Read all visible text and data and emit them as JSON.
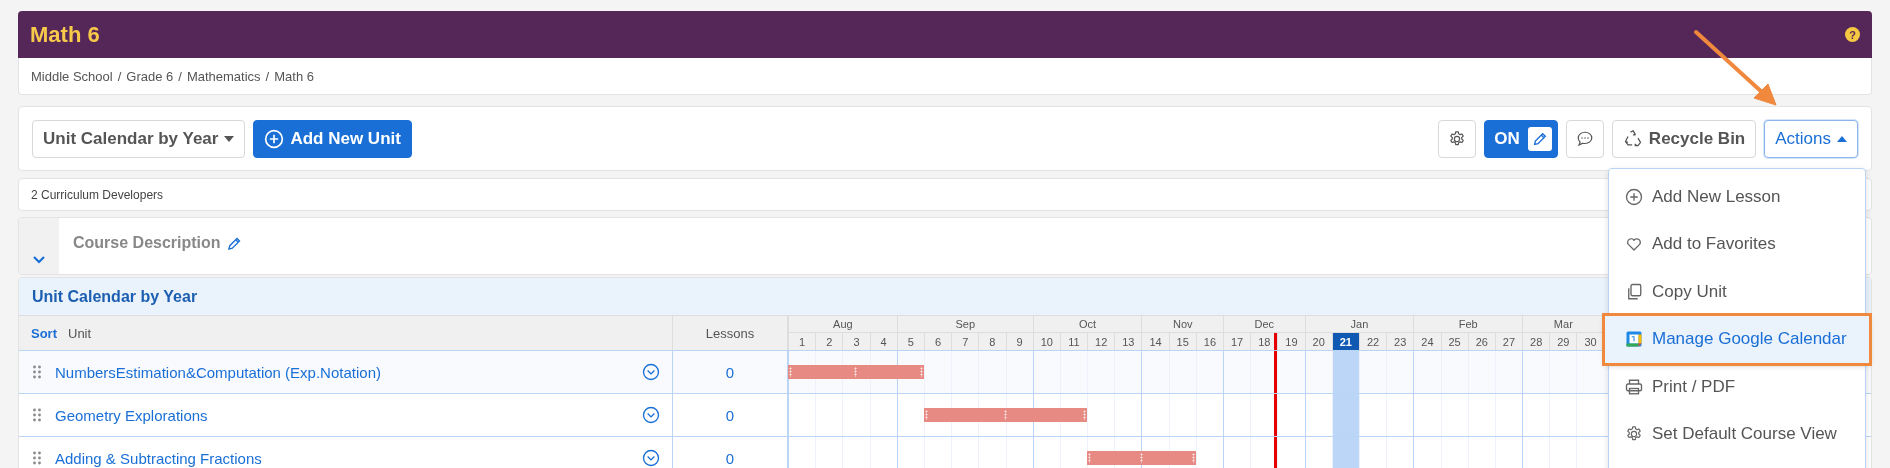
{
  "header": {
    "title": "Math 6",
    "help": "?"
  },
  "breadcrumb": {
    "separator": "/",
    "items": [
      "Middle School",
      "Grade 6",
      "Mathematics",
      "Math 6"
    ]
  },
  "toolbar": {
    "view_select": "Unit Calendar by Year",
    "add_unit": "Add New Unit",
    "edit_toggle": {
      "label": "ON",
      "on": true
    },
    "recycle_bin": "Recycle Bin",
    "actions": {
      "label": "Actions",
      "expanded": true
    }
  },
  "developers": "2 Curriculum Developers",
  "course_description": {
    "label": "Course Description",
    "expanded": false
  },
  "calendar": {
    "title": "Unit Calendar by Year",
    "columns": {
      "sort": "Sort",
      "unit": "Unit",
      "lessons": "Lessons"
    },
    "months": [
      {
        "label": "Aug",
        "weeks": [
          {
            "label": "1",
            "selected": false,
            "today": false
          },
          {
            "label": "2",
            "selected": false,
            "today": false
          },
          {
            "label": "3",
            "selected": false,
            "today": false
          },
          {
            "label": "4",
            "selected": false,
            "today": false
          }
        ]
      },
      {
        "label": "Sep",
        "weeks": [
          {
            "label": "5",
            "selected": false,
            "today": false
          },
          {
            "label": "6",
            "selected": false,
            "today": false
          },
          {
            "label": "7",
            "selected": false,
            "today": false
          },
          {
            "label": "8",
            "selected": false,
            "today": false
          },
          {
            "label": "9",
            "selected": false,
            "today": false
          }
        ]
      },
      {
        "label": "Oct",
        "weeks": [
          {
            "label": "10",
            "selected": false,
            "today": false
          },
          {
            "label": "11",
            "selected": false,
            "today": false
          },
          {
            "label": "12",
            "selected": false,
            "today": false
          },
          {
            "label": "13",
            "selected": false,
            "today": false
          }
        ]
      },
      {
        "label": "Nov",
        "weeks": [
          {
            "label": "14",
            "selected": false,
            "today": false
          },
          {
            "label": "15",
            "selected": false,
            "today": false
          },
          {
            "label": "16",
            "selected": false,
            "today": false
          }
        ]
      },
      {
        "label": "Dec",
        "weeks": [
          {
            "label": "17",
            "selected": false,
            "today": false
          },
          {
            "label": "18",
            "selected": false,
            "today": true
          },
          {
            "label": "19",
            "selected": false,
            "today": false
          }
        ]
      },
      {
        "label": "Jan",
        "weeks": [
          {
            "label": "20",
            "selected": false,
            "today": false
          },
          {
            "label": "21",
            "selected": true,
            "today": false
          },
          {
            "label": "22",
            "selected": false,
            "today": false
          },
          {
            "label": "23",
            "selected": false,
            "today": false
          }
        ]
      },
      {
        "label": "Feb",
        "weeks": [
          {
            "label": "24",
            "selected": false,
            "today": false
          },
          {
            "label": "25",
            "selected": false,
            "today": false
          },
          {
            "label": "26",
            "selected": false,
            "today": false
          },
          {
            "label": "27",
            "selected": false,
            "today": false
          }
        ]
      },
      {
        "label": "Mar",
        "weeks": [
          {
            "label": "28",
            "selected": false,
            "today": false
          },
          {
            "label": "29",
            "selected": false,
            "today": false
          },
          {
            "label": "30",
            "selected": false,
            "today": false
          }
        ]
      }
    ],
    "rows": [
      {
        "unit": "NumbersEstimation&Computation (Exp.Notation)",
        "lessons": "0",
        "schedule": [
          true,
          true,
          true,
          true,
          true,
          false,
          false,
          false,
          false,
          false,
          false,
          false,
          false,
          false,
          false,
          false,
          false,
          false,
          false,
          false,
          false,
          false,
          false,
          false,
          false,
          false,
          false,
          false,
          false,
          false
        ]
      },
      {
        "unit": "Geometry Explorations",
        "lessons": "0",
        "schedule": [
          false,
          false,
          false,
          false,
          false,
          true,
          true,
          true,
          true,
          true,
          true,
          false,
          false,
          false,
          false,
          false,
          false,
          false,
          false,
          false,
          false,
          false,
          false,
          false,
          false,
          false,
          false,
          false,
          false,
          false
        ]
      },
      {
        "unit": "Adding & Subtracting Fractions",
        "lessons": "0",
        "schedule": [
          false,
          false,
          false,
          false,
          false,
          false,
          false,
          false,
          false,
          false,
          false,
          true,
          true,
          true,
          true,
          false,
          false,
          false,
          false,
          false,
          false,
          false,
          false,
          false,
          false,
          false,
          false,
          false,
          false,
          false
        ]
      }
    ]
  },
  "actions_menu": [
    {
      "kind": "add",
      "label": "Add New Lesson",
      "selected": false
    },
    {
      "kind": "favorite",
      "label": "Add to Favorites",
      "selected": false
    },
    {
      "kind": "copy",
      "label": "Copy Unit",
      "selected": false
    },
    {
      "kind": "calendar",
      "label": "Manage Google Calendar",
      "selected": true
    },
    {
      "kind": "print",
      "label": "Print / PDF",
      "selected": false
    },
    {
      "kind": "settings",
      "label": "Set Default Course View",
      "selected": false
    }
  ]
}
